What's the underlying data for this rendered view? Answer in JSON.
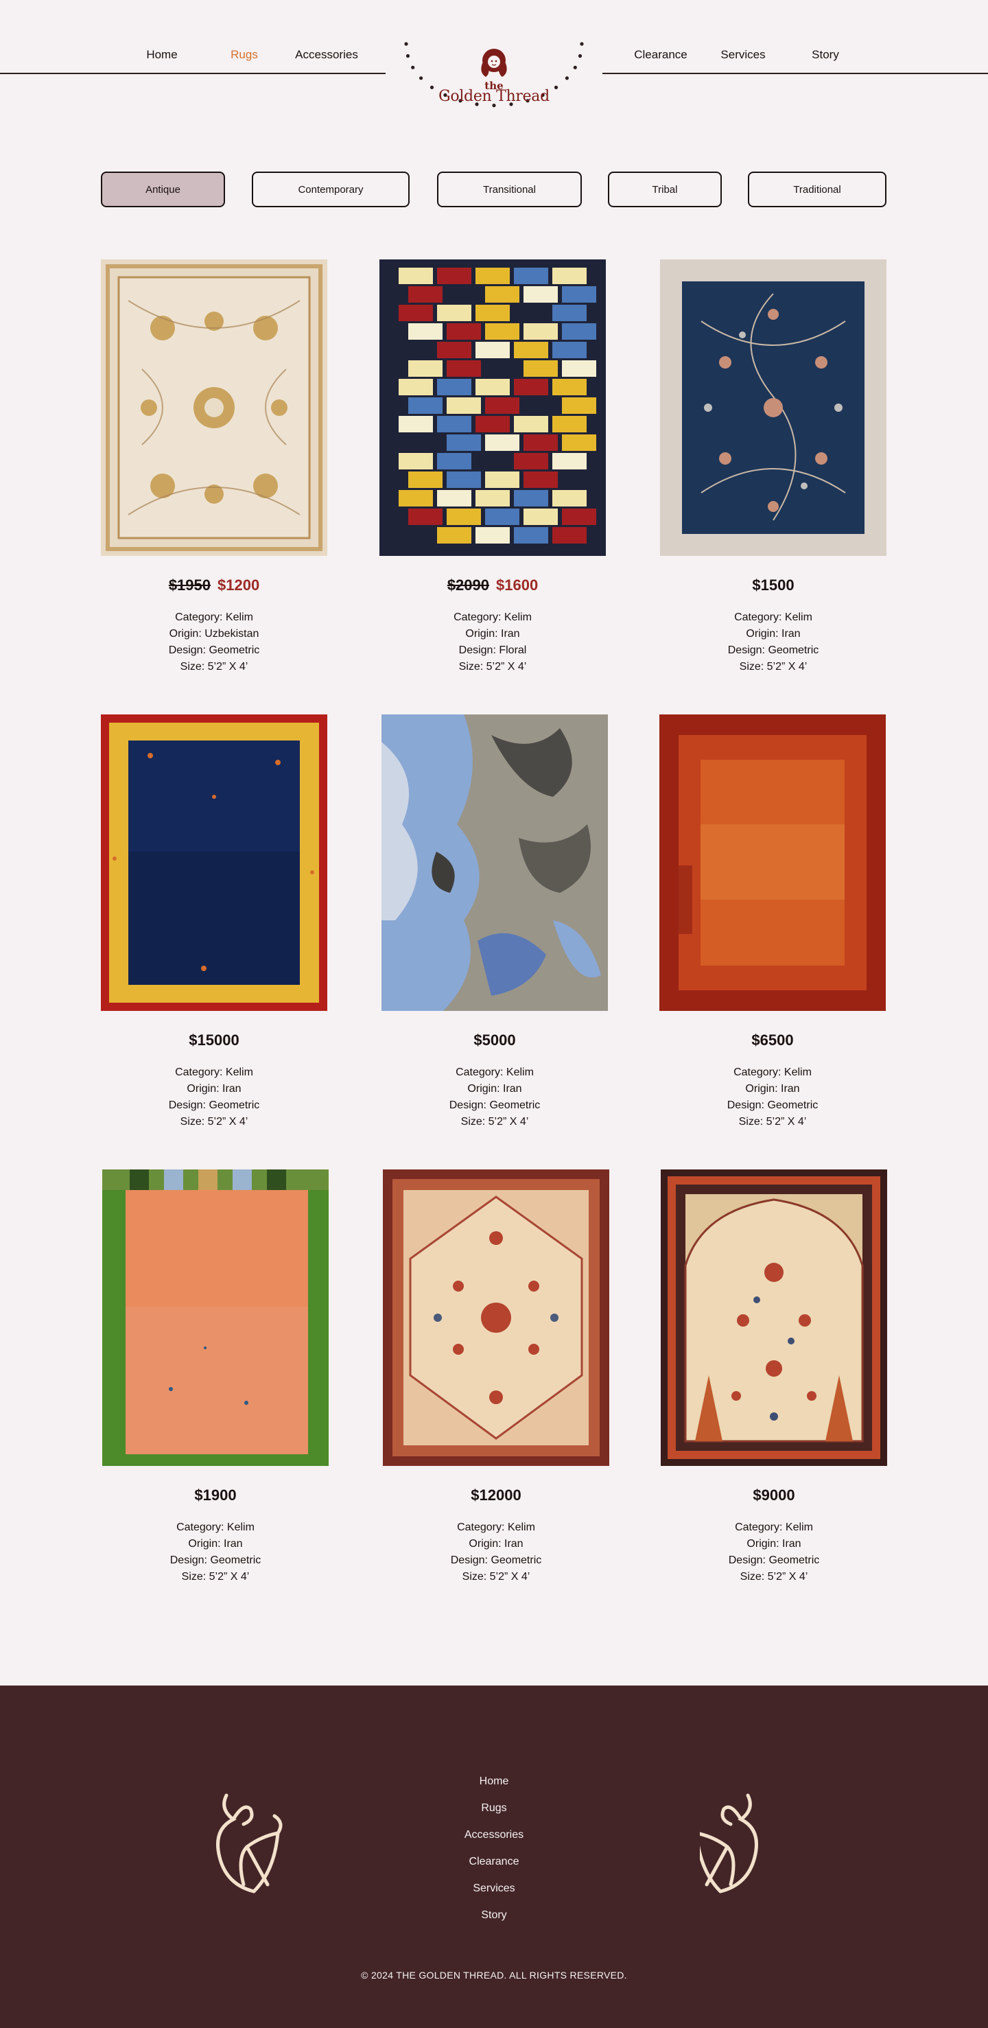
{
  "header": {
    "nav_left": [
      "Home",
      "Rugs",
      "Accessories"
    ],
    "nav_right": [
      "Clearance",
      "Services",
      "Story"
    ],
    "active": "Rugs",
    "logo": {
      "the": "the",
      "name": "Golden Thread"
    }
  },
  "filters": [
    "Antique",
    "Contemporary",
    "Transitional",
    "Tribal",
    "Traditional"
  ],
  "selected_filter": "Antique",
  "products": [
    {
      "price_old": "$1950",
      "price": "$1200",
      "category": "Category: Kelim",
      "origin": "Origin: Uzbekistan",
      "design": "Design: Geometric",
      "size": "Size: 5’2” X 4’",
      "image": "beige-floral-rug"
    },
    {
      "price_old": "$2090",
      "price": "$1600",
      "category": "Category: Kelim",
      "origin": "Origin: Iran",
      "design": "Design: Floral",
      "size": "Size: 5’2” X 4’",
      "image": "checkered-rug"
    },
    {
      "price_old": "",
      "price": "$1500",
      "category": "Category: Kelim",
      "origin": "Origin: Iran",
      "design": "Design: Geometric",
      "size": "Size: 5’2” X 4’",
      "image": "navy-floral-rug"
    },
    {
      "price_old": "",
      "price": "$15000",
      "category": "Category: Kelim",
      "origin": "Origin: Iran",
      "design": "Design: Geometric",
      "size": "Size: 5’2” X 4’",
      "image": "navy-gold-border-rug"
    },
    {
      "price_old": "",
      "price": "$5000",
      "category": "Category: Kelim",
      "origin": "Origin: Iran",
      "design": "Design: Geometric",
      "size": "Size: 5’2” X 4’",
      "image": "abstract-grey-blue-rug"
    },
    {
      "price_old": "",
      "price": "$6500",
      "category": "Category: Kelim",
      "origin": "Origin: Iran",
      "design": "Design: Geometric",
      "size": "Size: 5’2” X 4’",
      "image": "rust-red-rug"
    },
    {
      "price_old": "",
      "price": "$1900",
      "category": "Category: Kelim",
      "origin": "Origin: Iran",
      "design": "Design: Geometric",
      "size": "Size: 5’2” X 4’",
      "image": "peach-green-border-rug"
    },
    {
      "price_old": "",
      "price": "$12000",
      "category": "Category: Kelim",
      "origin": "Origin: Iran",
      "design": "Design: Geometric",
      "size": "Size: 5’2” X 4’",
      "image": "persian-medallion-rug"
    },
    {
      "price_old": "",
      "price": "$9000",
      "category": "Category: Kelim",
      "origin": "Origin: Iran",
      "design": "Design: Geometric",
      "size": "Size: 5’2” X 4’",
      "image": "prayer-rug"
    }
  ],
  "footer": {
    "links": [
      "Home",
      "Rugs",
      "Accessories",
      "Clearance",
      "Services",
      "Story"
    ],
    "copyright": "© 2024 THE GOLDEN THREAD. ALL RIGHTS RESERVED."
  },
  "colors": {
    "background": "#f6f1f2",
    "accent_orange": "#d4702f",
    "brand_maroon": "#7d1d1a",
    "sale_price": "#9c2a25",
    "footer_bg": "#432527",
    "filter_selected": "#cfbcc0"
  }
}
